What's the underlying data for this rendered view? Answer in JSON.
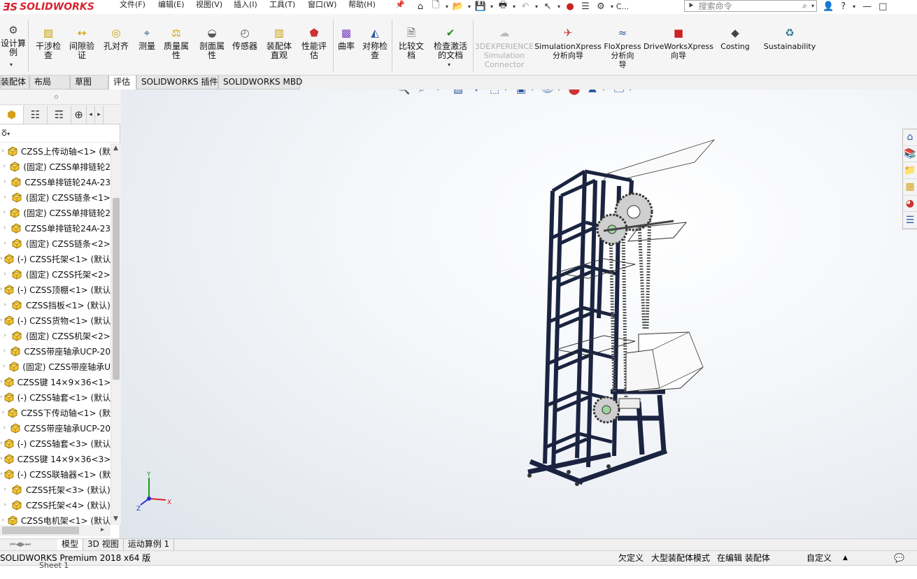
{
  "app": {
    "logo_text": "SOLIDWORKS",
    "logo_mark": "ƎS"
  },
  "menu": [
    "文件(F)",
    "编辑(E)",
    "视图(V)",
    "插入(I)",
    "工具(T)",
    "窗口(W)",
    "帮助(H)"
  ],
  "search": {
    "placeholder": "搜索命令",
    "prefix": "C..."
  },
  "commands": [
    {
      "label": "设计算\n例",
      "icon": "design-study-icon"
    },
    {
      "label": "干涉检\n查",
      "icon": "interference-check-icon"
    },
    {
      "label": "间隙验\n证",
      "icon": "clearance-verify-icon"
    },
    {
      "label": "孔对齐",
      "icon": "hole-alignment-icon"
    },
    {
      "label": "测量",
      "icon": "measure-icon"
    },
    {
      "label": "质量属\n性",
      "icon": "mass-properties-icon"
    },
    {
      "label": "剖面属\n性",
      "icon": "section-properties-icon"
    },
    {
      "label": "传感器",
      "icon": "sensor-icon"
    },
    {
      "label": "装配体\n直观",
      "icon": "assembly-visualization-icon"
    },
    {
      "label": "性能评\n估",
      "icon": "performance-evaluation-icon"
    },
    {
      "label": "曲率",
      "icon": "curvature-icon"
    },
    {
      "label": "对称检\n查",
      "icon": "symmetry-check-icon"
    },
    {
      "label": "比较文\n档",
      "icon": "compare-documents-icon"
    },
    {
      "label": "检查激活\n的文档",
      "icon": "check-active-document-icon"
    },
    {
      "label": "3DEXPERIENCE\nSimulation\nConnector",
      "icon": "3dexperience-icon",
      "disabled": true
    },
    {
      "label": "SimulationXpress\n分析向导",
      "icon": "simulationxpress-icon"
    },
    {
      "label": "FloXpress\n分析向\n导",
      "icon": "floxpress-icon"
    },
    {
      "label": "DriveWorksXpress\n向导",
      "icon": "driveworksxpress-icon"
    },
    {
      "label": "Costing",
      "icon": "costing-icon"
    },
    {
      "label": "Sustainability",
      "icon": "sustainability-icon"
    }
  ],
  "tabs": [
    "装配体",
    "布局",
    "草图",
    "评估",
    "SOLIDWORKS 插件",
    "SOLIDWORKS MBD"
  ],
  "active_tab": "评估",
  "tree": [
    "CZSS上传动轴<1> (默",
    "(固定) CZSS单排链轮2",
    "CZSS单排链轮24A-23",
    "(固定) CZSS链条<1>",
    "(固定) CZSS单排链轮2",
    "CZSS单排链轮24A-23",
    "(固定) CZSS链条<2>",
    "(-) CZSS托架<1> (默认",
    "(固定) CZSS托架<2>",
    "(-) CZSS顶棚<1> (默认",
    "CZSS挡板<1> (默认)",
    "(-) CZSS货物<1> (默认",
    "(固定) CZSS机架<2>",
    "CZSS带座轴承UCP-20",
    "(固定) CZSS带座轴承U",
    "CZSS键 14×9×36<1>",
    "(-) CZSS轴套<1> (默认",
    "CZSS下传动轴<1> (默",
    "CZSS带座轴承UCP-20",
    "(-) CZSS轴套<3> (默认",
    "CZSS键 14×9×36<3>",
    "(-) CZSS联轴器<1> (默",
    "CZSS托架<3> (默认)",
    "CZSS托架<4> (默认)",
    "CZSS电机架<1> (默认"
  ],
  "bottom_tabs": [
    "模型",
    "3D 视图",
    "运动算例 1"
  ],
  "status": {
    "product": "SOLIDWORKS Premium 2018 x64 版",
    "underdefined": "欠定义",
    "large_assembly": "大型装配体模式",
    "editing": "在编辑 装配体",
    "units": "自定义"
  },
  "strip_text": "Sheet 1",
  "triad": {
    "x": "X",
    "y": "Y",
    "z": "Z"
  },
  "colors": {
    "frame": "#1a2440",
    "accent": "#2d5aa0",
    "logo": "#d9232e"
  }
}
